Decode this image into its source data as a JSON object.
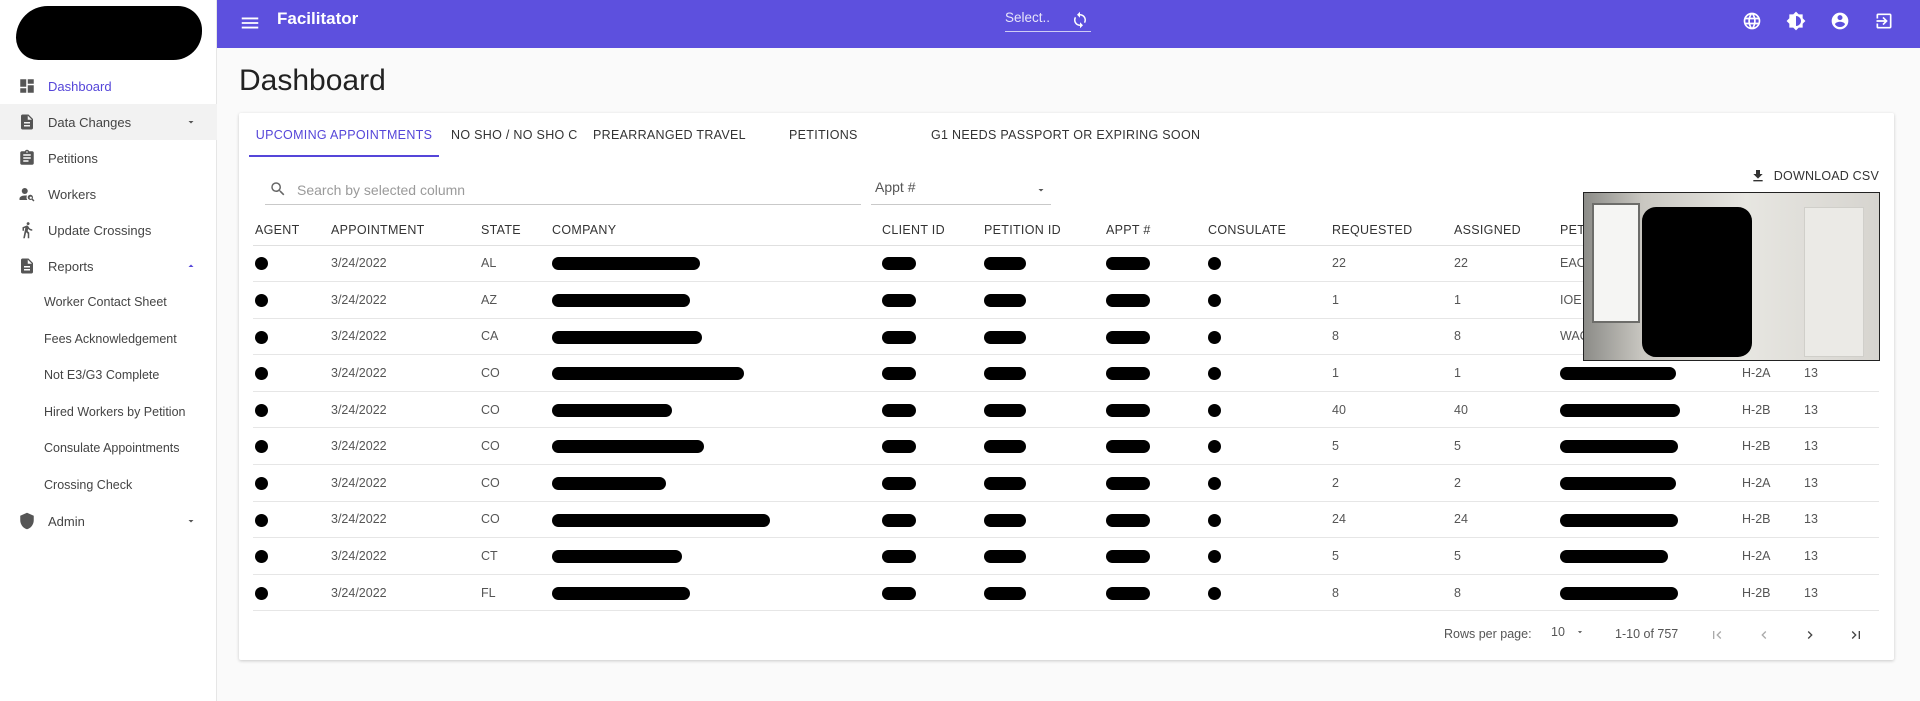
{
  "app": {
    "title": "Facilitator"
  },
  "topbar": {
    "select_value": "Select..",
    "icons": [
      "globe-icon",
      "brightness-icon",
      "account-icon",
      "logout-icon"
    ]
  },
  "sidebar": {
    "items": [
      {
        "label": "Dashboard",
        "icon": "dashboard-icon",
        "active": true
      },
      {
        "label": "Data Changes",
        "icon": "document-icon",
        "expandable": true
      },
      {
        "label": "Petitions",
        "icon": "clipboard-icon"
      },
      {
        "label": "Workers",
        "icon": "worker-search-icon"
      },
      {
        "label": "Update Crossings",
        "icon": "walking-icon"
      },
      {
        "label": "Reports",
        "icon": "document-icon",
        "expandable": true,
        "expanded": true
      },
      {
        "label": "Admin",
        "icon": "shield-icon",
        "expandable": true
      }
    ],
    "reports_sub": [
      "Worker Contact Sheet",
      "Fees Acknowledgement",
      "Not E3/G3 Complete",
      "Hired Workers by Petition",
      "Consulate Appointments",
      "Crossing Check"
    ]
  },
  "page": {
    "title": "Dashboard"
  },
  "tabs": [
    "UPCOMING APPOINTMENTS",
    "NO SHO / NO SHO C",
    "PREARRANGED TRAVEL",
    "PETITIONS",
    "G1 NEEDS PASSPORT OR EXPIRING SOON"
  ],
  "toolbar": {
    "download_label": "DOWNLOAD CSV",
    "search_placeholder": "Search by selected column",
    "column_select": "Appt #"
  },
  "table": {
    "headers": [
      "AGENT",
      "APPOINTMENT",
      "STATE",
      "COMPANY",
      "CLIENT ID",
      "PETITION ID",
      "APPT #",
      "CONSULATE",
      "REQUESTED",
      "ASSIGNED",
      "PET",
      "",
      ""
    ],
    "rows": [
      {
        "appointment": "3/24/2022",
        "state": "AL",
        "requested": "22",
        "assigned": "22",
        "pet": "EAC",
        "type": "",
        "num": ""
      },
      {
        "appointment": "3/24/2022",
        "state": "AZ",
        "requested": "1",
        "assigned": "1",
        "pet": "IOE",
        "type": "",
        "num": ""
      },
      {
        "appointment": "3/24/2022",
        "state": "CA",
        "requested": "8",
        "assigned": "8",
        "pet": "WAC",
        "type": "",
        "num": ""
      },
      {
        "appointment": "3/24/2022",
        "state": "CO",
        "requested": "1",
        "assigned": "1",
        "pet": "",
        "type": "H-2A",
        "num": "13"
      },
      {
        "appointment": "3/24/2022",
        "state": "CO",
        "requested": "40",
        "assigned": "40",
        "pet": "",
        "type": "H-2B",
        "num": "13"
      },
      {
        "appointment": "3/24/2022",
        "state": "CO",
        "requested": "5",
        "assigned": "5",
        "pet": "",
        "type": "H-2B",
        "num": "13"
      },
      {
        "appointment": "3/24/2022",
        "state": "CO",
        "requested": "2",
        "assigned": "2",
        "pet": "",
        "type": "H-2A",
        "num": "13"
      },
      {
        "appointment": "3/24/2022",
        "state": "CO",
        "requested": "24",
        "assigned": "24",
        "pet": "",
        "type": "H-2B",
        "num": "13"
      },
      {
        "appointment": "3/24/2022",
        "state": "CT",
        "requested": "5",
        "assigned": "5",
        "pet": "",
        "type": "H-2A",
        "num": "13"
      },
      {
        "appointment": "3/24/2022",
        "state": "FL",
        "requested": "8",
        "assigned": "8",
        "pet": "",
        "type": "H-2B",
        "num": "13"
      }
    ]
  },
  "pagination": {
    "rows_per_page_label": "Rows per page:",
    "rows_per_page": "10",
    "range": "1-10 of 757"
  },
  "colors": {
    "primary": "#5d50de",
    "accent": "#5546d9"
  }
}
